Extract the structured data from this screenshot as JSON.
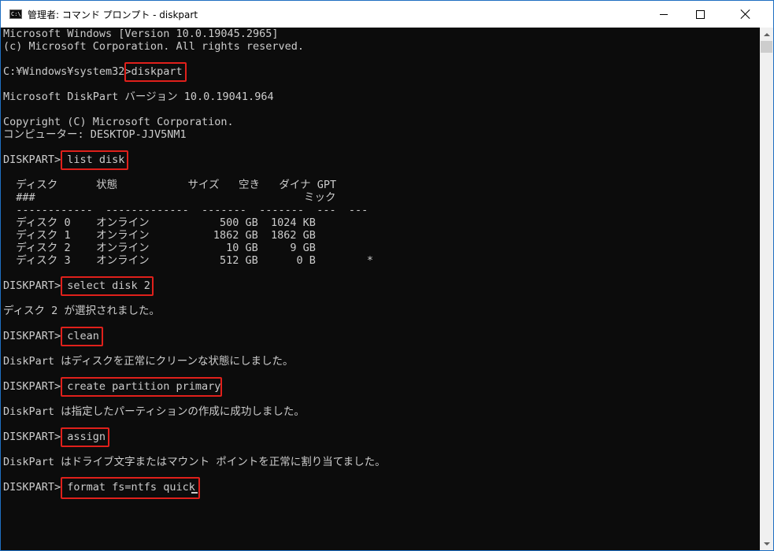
{
  "window": {
    "title": "管理者: コマンド プロンプト - diskpart",
    "icon_text": "C:\\."
  },
  "console": {
    "lines": [
      "Microsoft Windows [Version 10.0.19045.2965]",
      "(c) Microsoft Corporation. All rights reserved.",
      "",
      "C:¥Windows¥system32>diskpart",
      "",
      "Microsoft DiskPart バージョン 10.0.19041.964",
      "",
      "Copyright (C) Microsoft Corporation.",
      "コンピューター: DESKTOP-JJV5NM1",
      "",
      "DISKPART> list disk",
      "",
      "  ディスク      状態           サイズ   空き   ダイナ GPT",
      "  ###                                          ミック",
      "  ------------  -------------  -------  -------  ---  ---",
      "  ディスク 0    オンライン           500 GB  1024 KB",
      "  ディスク 1    オンライン          1862 GB  1862 GB",
      "  ディスク 2    オンライン            10 GB     9 GB",
      "  ディスク 3    オンライン           512 GB      0 B        *",
      "",
      "DISKPART> select disk 2",
      "",
      "ディスク 2 が選択されました。",
      "",
      "DISKPART> clean",
      "",
      "DiskPart はディスクを正常にクリーンな状態にしました。",
      "",
      "DISKPART> create partition primary",
      "",
      "DiskPart は指定したパーティションの作成に成功しました。",
      "",
      "DISKPART> assign",
      "",
      "DiskPart はドライブ文字またはマウント ポイントを正常に割り当てました。",
      "",
      "DISKPART> format fs=ntfs quick"
    ]
  }
}
